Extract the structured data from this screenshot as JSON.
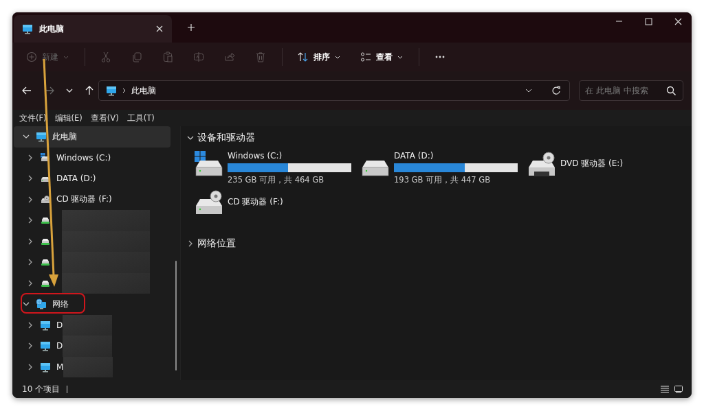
{
  "tabs": [
    {
      "label": "此电脑",
      "selected": true
    }
  ],
  "toolbar": {
    "groups": [
      [
        {
          "kind": "new",
          "label": "新建",
          "disabled": true
        }
      ],
      [
        {
          "kind": "cut",
          "disabled": true
        },
        {
          "kind": "copy",
          "disabled": true
        },
        {
          "kind": "paste",
          "disabled": true
        },
        {
          "kind": "rename",
          "disabled": true
        },
        {
          "kind": "share",
          "disabled": true
        },
        {
          "kind": "delete",
          "disabled": true
        }
      ],
      [
        {
          "kind": "sort",
          "label": "排序",
          "disabled": false
        },
        {
          "kind": "view",
          "label": "查看",
          "disabled": false
        }
      ],
      [
        {
          "kind": "more",
          "disabled": false
        }
      ]
    ]
  },
  "address": {
    "path": "此电脑",
    "search_placeholder": "在 此电脑 中搜索"
  },
  "menu": [
    "文件(F)",
    "编辑(E)",
    "查看(V)",
    "工具(T)"
  ],
  "sidebar": {
    "items": [
      {
        "kind": "pc",
        "label": "此电脑",
        "selected": true,
        "expanded": true,
        "blurred": false,
        "children": [
          {
            "kind": "windows-drive",
            "label": "Windows (C:)",
            "selected": false,
            "expanded": false,
            "blurred": false
          },
          {
            "kind": "drive",
            "label": "DATA (D:)",
            "selected": false,
            "expanded": false,
            "blurred": false
          },
          {
            "kind": "cd-drive",
            "label": "CD 驱动器 (F:)",
            "selected": false,
            "expanded": false,
            "blurred": false
          },
          {
            "kind": "network-drive",
            "selected": false,
            "expanded": false,
            "blurred": true
          },
          {
            "kind": "network-drive",
            "selected": false,
            "expanded": false,
            "blurred": true
          },
          {
            "kind": "network-drive",
            "selected": false,
            "expanded": false,
            "blurred": true
          },
          {
            "kind": "network-drive",
            "selected": false,
            "expanded": false,
            "blurred": true
          }
        ]
      },
      {
        "kind": "network",
        "label": "网络",
        "selected": false,
        "expanded": true,
        "blurred": false,
        "children": [
          {
            "kind": "pc",
            "label": "D",
            "selected": false,
            "expanded": false,
            "blurred": true
          },
          {
            "kind": "pc",
            "label": "D",
            "selected": false,
            "expanded": false,
            "blurred": true
          },
          {
            "kind": "pc",
            "label": "M",
            "selected": false,
            "expanded": false,
            "blurred": true
          }
        ]
      }
    ]
  },
  "sections": [
    {
      "title": "设备和驱动器",
      "expanded": true,
      "drives": [
        {
          "kind": "windows-drive",
          "name": "Windows (C:)",
          "level": 0.49,
          "reading": "235 GB 可用，共 464 GB"
        },
        {
          "kind": "drive",
          "name": "DATA (D:)",
          "level": 0.57,
          "reading": "193 GB 可用，共 447 GB"
        },
        {
          "kind": "dvd-drive",
          "name": "DVD 驱动器 (E:)"
        },
        {
          "kind": "cd-drive",
          "name": "CD 驱动器 (F:)"
        }
      ]
    },
    {
      "title": "网络位置",
      "expanded": false
    }
  ],
  "status_bar": {
    "count": "10 个项目"
  }
}
